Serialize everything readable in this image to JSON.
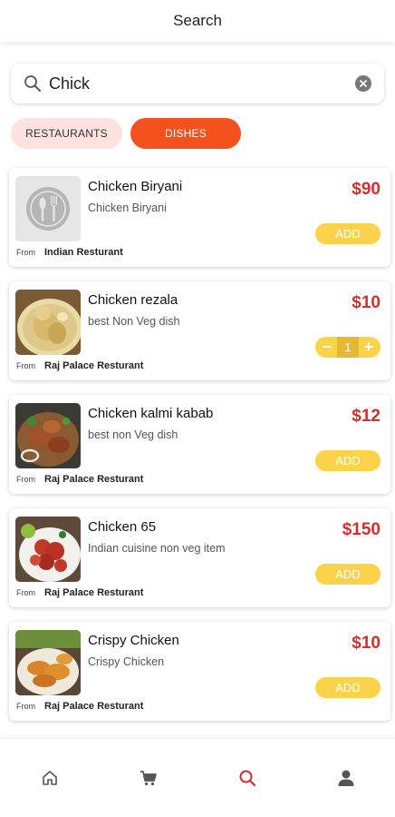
{
  "header": {
    "title": "Search"
  },
  "search": {
    "value": "Chick",
    "icon": "search-icon",
    "clear_icon": "close-icon"
  },
  "tabs": [
    {
      "label": "RESTAURANTS",
      "active": false
    },
    {
      "label": "DISHES",
      "active": true
    }
  ],
  "colors": {
    "accent": "#f4511e",
    "price": "#d32f2f",
    "add_button": "#fbd34b"
  },
  "items": [
    {
      "name": "Chicken Biryani",
      "description": "Chicken Biryani",
      "price": "$90",
      "from_label": "From",
      "restaurant": "Indian Resturant",
      "action": "ADD",
      "image": "placeholder-cutlery"
    },
    {
      "name": "Chicken rezala",
      "description": "best Non Veg dish",
      "price": "$10",
      "from_label": "From",
      "restaurant": "Raj Palace Resturant",
      "quantity": "1",
      "image": "chicken-rezala-photo"
    },
    {
      "name": "Chicken kalmi kabab",
      "description": "best non Veg dish",
      "price": "$12",
      "from_label": "From",
      "restaurant": "Raj Palace Resturant",
      "action": "ADD",
      "image": "chicken-kalmi-kabab-photo"
    },
    {
      "name": "Chicken 65",
      "description": "Indian cuisine non veg item",
      "price": "$150",
      "from_label": "From",
      "restaurant": "Raj Palace Resturant",
      "action": "ADD",
      "image": "chicken-65-photo"
    },
    {
      "name": "Crispy Chicken",
      "description": "Crispy Chicken",
      "price": "$10",
      "from_label": "From",
      "restaurant": "Raj Palace Resturant",
      "action": "ADD",
      "image": "crispy-chicken-photo"
    }
  ],
  "bottom_nav": [
    {
      "icon": "home-icon",
      "active": false
    },
    {
      "icon": "cart-icon",
      "active": false
    },
    {
      "icon": "search-icon",
      "active": true
    },
    {
      "icon": "profile-icon",
      "active": false
    }
  ]
}
